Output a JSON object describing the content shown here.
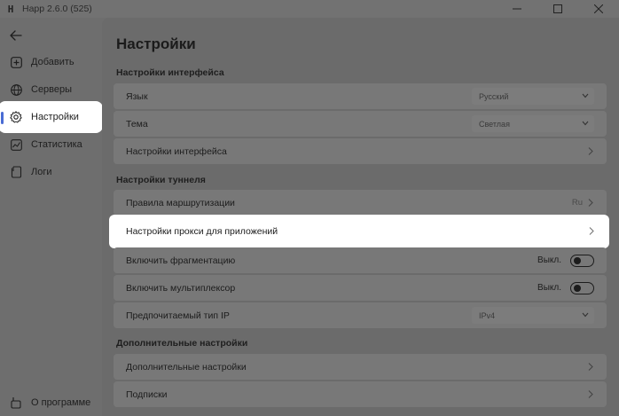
{
  "window": {
    "logo_glyph": "H",
    "title": "Happ 2.6.0 (525)"
  },
  "sidebar": {
    "items": [
      {
        "label": "Добавить",
        "icon": "add-box-icon"
      },
      {
        "label": "Серверы",
        "icon": "globe-icon"
      },
      {
        "label": "Настройки",
        "icon": "gear-icon",
        "active": true
      },
      {
        "label": "Статистика",
        "icon": "chart-icon"
      },
      {
        "label": "Логи",
        "icon": "log-file-icon"
      }
    ],
    "about": {
      "label": "О программе",
      "icon": "info-icon"
    }
  },
  "main": {
    "title": "Настройки",
    "sections": {
      "interface": {
        "title": "Настройки интерфейса",
        "language": {
          "label": "Язык",
          "value": "Русский"
        },
        "theme": {
          "label": "Тема",
          "value": "Светлая"
        },
        "interface_settings": {
          "label": "Настройки интерфейса"
        }
      },
      "tunnel": {
        "title": "Настройки туннеля",
        "routing": {
          "label": "Правила маршрутизации",
          "hint": "Ru"
        },
        "proxy_apps": {
          "label": "Настройки прокси для приложений"
        },
        "fragmentation": {
          "label": "Включить фрагментацию",
          "state": "Выкл."
        },
        "multiplexor": {
          "label": "Включить мультиплексор",
          "state": "Выкл."
        },
        "ip_type": {
          "label": "Предпочитаемый тип IP",
          "value": "IPv4"
        }
      },
      "additional": {
        "title": "Дополнительные настройки",
        "extra": {
          "label": "Дополнительные настройки"
        },
        "subscriptions": {
          "label": "Подписки"
        }
      }
    }
  },
  "colors": {
    "accent": "#4a6cd4",
    "highlight": "#ffffff",
    "dim_background": "#6e6e6e"
  }
}
